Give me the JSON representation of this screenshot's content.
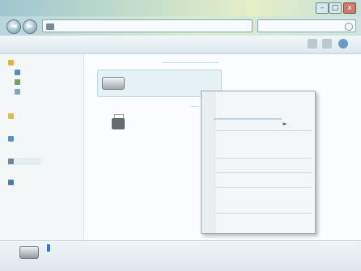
{
  "window": {
    "title": "",
    "minimize_symbol": "–",
    "maximize_symbol": "□",
    "close_symbol": "x"
  },
  "address": {
    "back_symbol": "◄",
    "forward_symbol": "►",
    "path": "",
    "search_placeholder": ""
  },
  "toolbar": {
    "organize": "",
    "properties": "",
    "system_properties": "",
    "map_network_drive": ""
  },
  "nav": {
    "favorites": "",
    "desktop": "",
    "downloads": "",
    "recent_places": "",
    "libraries": "",
    "homegroup": "",
    "computer": "",
    "network": ""
  },
  "content": {
    "group_hdd_header": "",
    "drive_name": "",
    "drive_detail": "",
    "group_removable_header": "",
    "printer_name": ""
  },
  "context_menu": {
    "items": [
      "",
      "",
      "",
      "",
      "",
      "",
      "",
      "",
      "",
      ""
    ],
    "submenu_arrow": "►"
  },
  "details": {
    "name": "",
    "name_highlight": "",
    "type": "",
    "space_used": "",
    "free_space": ""
  },
  "icons": [
    "search-icon",
    "hard-drive-icon",
    "printer-icon",
    "folder-icon",
    "computer-icon",
    "network-icon",
    "back-icon",
    "forward-icon",
    "close-icon"
  ]
}
